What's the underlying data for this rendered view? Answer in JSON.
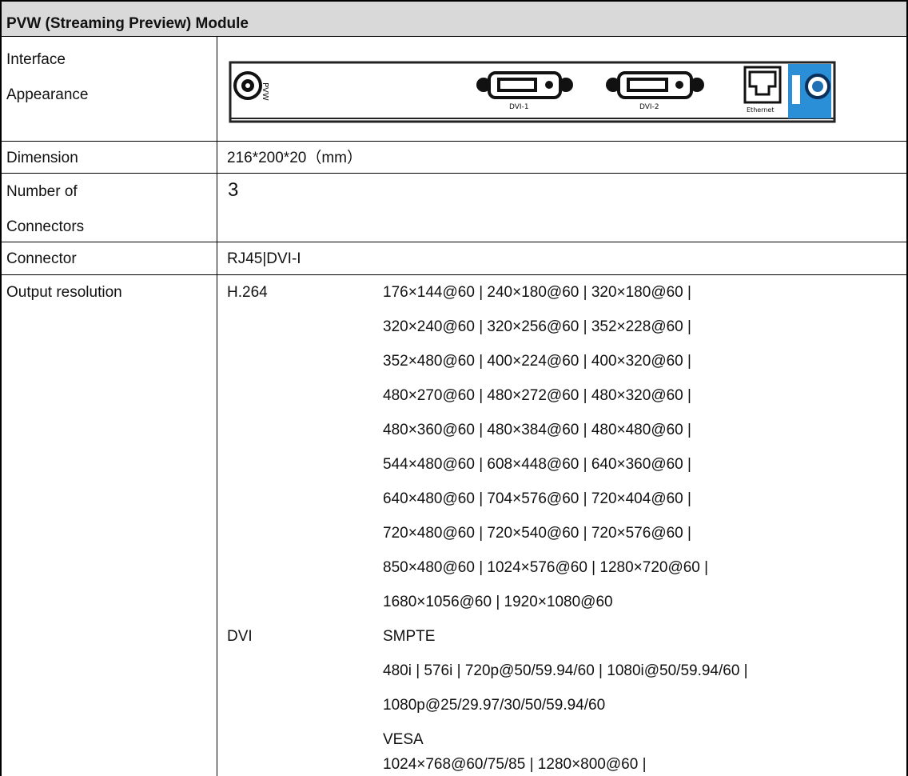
{
  "table": {
    "title": "PVW (Streaming Preview) Module",
    "rows": {
      "interface": {
        "label_line1": "Interface",
        "label_line2": "Appearance",
        "panel_marks": {
          "port1": "DVI-1",
          "port2": "DVI-2",
          "port3": "Ethernet",
          "side": "PVW"
        }
      },
      "dimension": {
        "label": "Dimension",
        "value": "216*200*20（mm）"
      },
      "connectors": {
        "label_line1": "Number of",
        "label_line2": "Connectors",
        "value": "3"
      },
      "connector": {
        "label": "Connector",
        "value": "RJ45|DVI-I"
      },
      "output": {
        "label": "Output resolution",
        "h264": {
          "label": "H.264",
          "lines": [
            "176×144@60 | 240×180@60 | 320×180@60 |",
            "320×240@60 | 320×256@60 | 352×228@60 |",
            "352×480@60 | 400×224@60 | 400×320@60 |",
            "480×270@60 | 480×272@60 | 480×320@60 |",
            "480×360@60 | 480×384@60 | 480×480@60 |",
            "544×480@60 | 608×448@60 | 640×360@60 |",
            "640×480@60 | 704×576@60 | 720×404@60 |",
            "720×480@60 | 720×540@60 | 720×576@60 |",
            "850×480@60 | 1024×576@60 | 1280×720@60 |",
            "1680×1056@60 | 1920×1080@60"
          ]
        },
        "dvi": {
          "label": "DVI",
          "lines": [
            "SMPTE",
            "480i | 576i | 720p@50/59.94/60 | 1080i@50/59.94/60 |",
            "1080p@25/29.97/30/50/59.94/60",
            "VESA",
            "1024×768@60/75/85 | 1280×800@60 |"
          ]
        }
      }
    }
  }
}
